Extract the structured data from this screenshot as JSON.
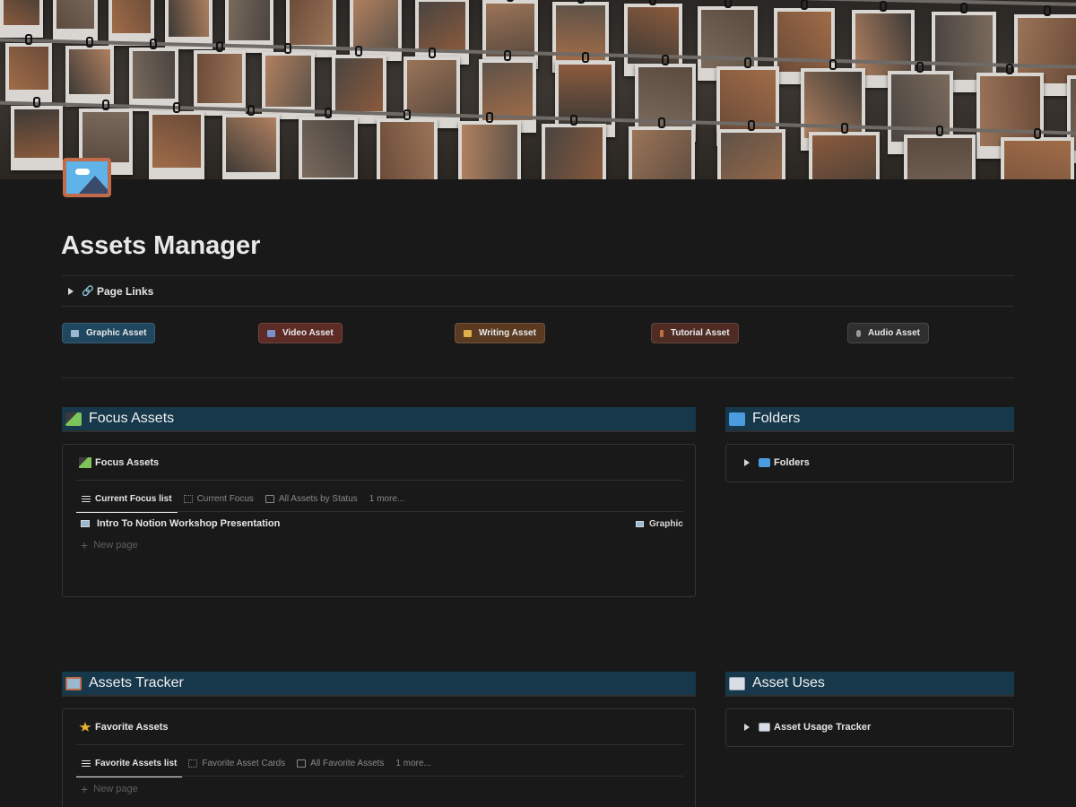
{
  "page": {
    "title": "Assets Manager",
    "cover_image": "polaroid-photo-wall",
    "icon": "framed-picture-icon"
  },
  "page_links": {
    "label": "Page Links",
    "icon": "link-icon"
  },
  "asset_buttons": [
    {
      "label": "Graphic Asset",
      "icon": "framed-picture-icon",
      "color": "#1f4760"
    },
    {
      "label": "Video Asset",
      "icon": "film-icon",
      "color": "#5c2b26"
    },
    {
      "label": "Writing Asset",
      "icon": "writing-hand-icon",
      "color": "#5a3b22"
    },
    {
      "label": "Tutorial Asset",
      "icon": "paintbrush-icon",
      "color": "#4e2c24"
    },
    {
      "label": "Audio Asset",
      "icon": "microphone-icon",
      "color": "#2f2f2f"
    }
  ],
  "sections": {
    "focus": {
      "heading": "Focus Assets",
      "icon": "clapper-board-icon",
      "db_title": "Focus Assets",
      "tabs": [
        "Current Focus list",
        "Current Focus",
        "All Assets by Status",
        "1 more..."
      ],
      "rows": [
        {
          "title": "Intro To Notion Workshop Presentation",
          "type": "Graphic"
        }
      ],
      "new_page": "New page"
    },
    "folders": {
      "heading": "Folders",
      "icon": "folder-icon",
      "toggle_label": "Folders"
    },
    "tracker": {
      "heading": "Assets Tracker",
      "icon": "framed-picture-icon",
      "db_title": "Favorite Assets",
      "tabs": [
        "Favorite Assets list",
        "Favorite Asset Cards",
        "All Favorite Assets",
        "1 more..."
      ],
      "new_page": "New page"
    },
    "uses": {
      "heading": "Asset Uses",
      "icon": "card-index-icon",
      "toggle_label": "Asset Usage Tracker"
    }
  },
  "colors": {
    "background": "#191919",
    "section_header": "#17384b",
    "text": "#e6e6e6",
    "muted": "#8a8a8a"
  }
}
